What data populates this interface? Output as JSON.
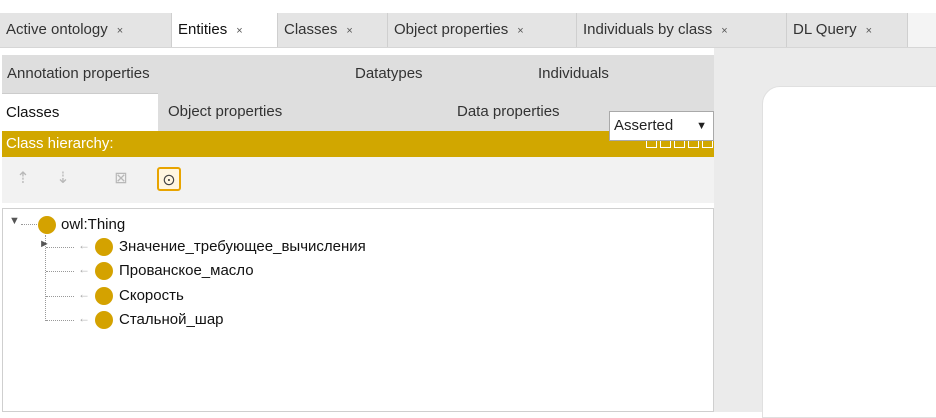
{
  "tabs": [
    {
      "label": "Active ontology",
      "active": false
    },
    {
      "label": "Entities",
      "active": true
    },
    {
      "label": "Classes",
      "active": false
    },
    {
      "label": "Object properties",
      "active": false
    },
    {
      "label": "Individuals by class",
      "active": false
    },
    {
      "label": "DL Query",
      "active": false
    }
  ],
  "close_glyph": "×",
  "subtabs_row1": [
    {
      "label": "Annotation properties"
    },
    {
      "label": "Datatypes"
    },
    {
      "label": "Individuals"
    }
  ],
  "subtabs_row2": [
    {
      "label": "Classes",
      "active": true
    },
    {
      "label": "Object properties",
      "active": false
    },
    {
      "label": "Data properties",
      "active": false
    }
  ],
  "hierarchy": {
    "title": "Class hierarchy:",
    "view_mode": "Asserted",
    "icons": [
      "add-subclass-icon",
      "add-sibling-class-icon",
      "delete-class-icon",
      "find-usage-icon"
    ]
  },
  "tree": {
    "root": "owl:Thing",
    "children": [
      {
        "label": "Значение_требующее_вычисления",
        "expandable": true
      },
      {
        "label": "Прованское_масло",
        "expandable": false
      },
      {
        "label": "Скорость",
        "expandable": false
      },
      {
        "label": "Стальной_шар",
        "expandable": false
      }
    ]
  },
  "colors": {
    "accent": "#d1a700",
    "class_dot": "#d4a200",
    "selected_border": "#e8a400"
  }
}
